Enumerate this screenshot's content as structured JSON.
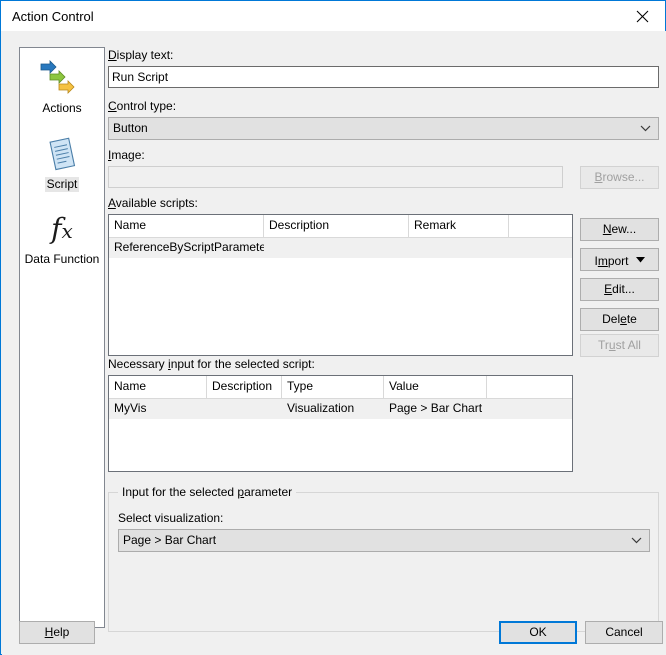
{
  "window": {
    "title": "Action Control",
    "close_icon": "close-icon"
  },
  "sidebar": {
    "items": [
      {
        "label": "Actions",
        "icon": "arrows-icon",
        "selected": false
      },
      {
        "label": "Script",
        "icon": "script-document-icon",
        "selected": true
      },
      {
        "label": "Data Function",
        "icon": "fx-icon",
        "selected": false
      }
    ]
  },
  "form": {
    "display_text_label": "Display text:",
    "display_text_value": "Run Script",
    "control_type_label": "Control type:",
    "control_type_value": "Button",
    "image_label": "Image:",
    "image_value": "",
    "image_placeholder": "",
    "browse_label": "Browse..."
  },
  "scripts": {
    "section_label": "Available scripts:",
    "columns": [
      "Name",
      "Description",
      "Remark"
    ],
    "rows": [
      {
        "name": "ReferenceByScriptParameter",
        "description": "",
        "remark": ""
      }
    ],
    "buttons": [
      {
        "label": "New...",
        "enabled": true,
        "dropdown": false
      },
      {
        "label": "Import",
        "enabled": true,
        "dropdown": true
      },
      {
        "label": "Edit...",
        "enabled": true,
        "dropdown": false
      },
      {
        "label": "Delete",
        "enabled": true,
        "dropdown": false
      },
      {
        "label": "Trust All",
        "enabled": false,
        "dropdown": false
      }
    ]
  },
  "parameters": {
    "section_label": "Necessary input for the selected script:",
    "columns": [
      "Name",
      "Description",
      "Type",
      "Value"
    ],
    "rows": [
      {
        "name": "MyVis",
        "description": "",
        "type": "Visualization",
        "value": "Page > Bar Chart"
      }
    ]
  },
  "parameter_input": {
    "group_title": "Input for the selected parameter",
    "select_label": "Select visualization:",
    "select_value": "Page > Bar Chart"
  },
  "footer": {
    "help_label": "Help",
    "ok_label": "OK",
    "cancel_label": "Cancel"
  },
  "colors": {
    "accent": "#0078d7",
    "dialog_bg": "#f0f0f0",
    "arrow_blue": "#2878be",
    "arrow_green": "#7cb342",
    "arrow_yellow": "#e8a838",
    "doc_blue": "#b3d4ef"
  }
}
